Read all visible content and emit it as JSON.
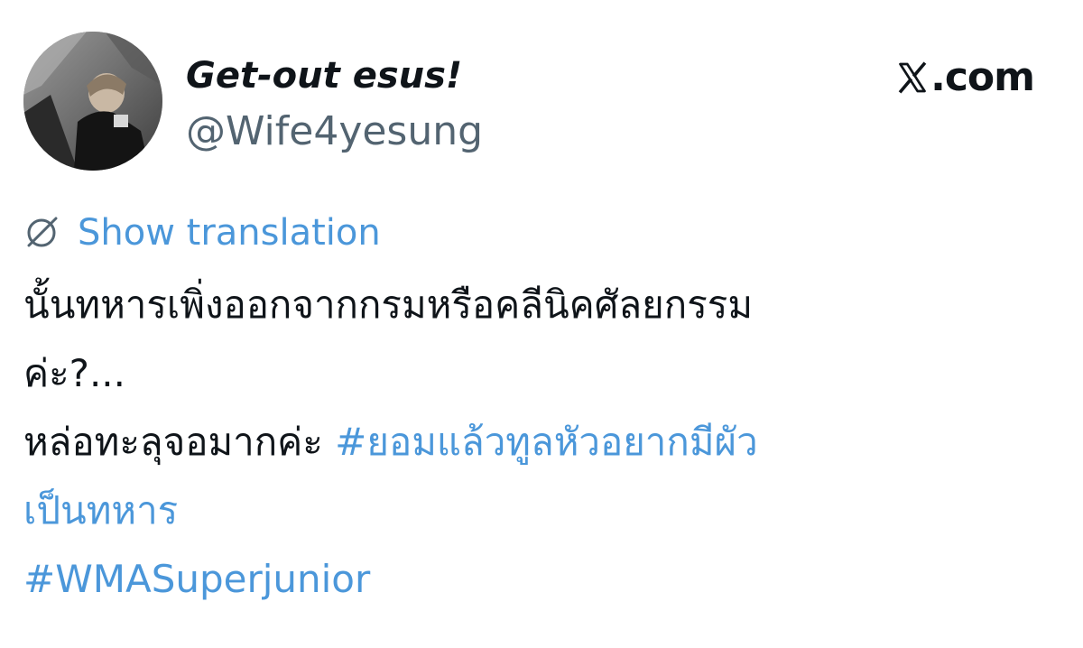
{
  "tweet": {
    "author": {
      "display_name": "Get-out esus!",
      "handle": "@Wife4yesung"
    },
    "brand": {
      "text": ".com",
      "icon": "x-logo-icon"
    },
    "translate": {
      "icon": "globe-icon",
      "label": "Show translation"
    },
    "body": {
      "line1": "นั้นทหารเพิ่งออกจากกรมหรือคลีนิคศัลยกรรม",
      "line2": "ค่ะ?...",
      "line3_text": "หล่อทะลุจอมากค่ะ ",
      "hashtag1_part1": "#ยอมแล้วทูลหัวอยากมีผัว",
      "hashtag1_part2": "เป็นทหาร",
      "hashtag2": "#WMASuperjunior"
    },
    "colors": {
      "link": "#4b97da",
      "text": "#0f1419",
      "secondary": "#536471"
    }
  }
}
